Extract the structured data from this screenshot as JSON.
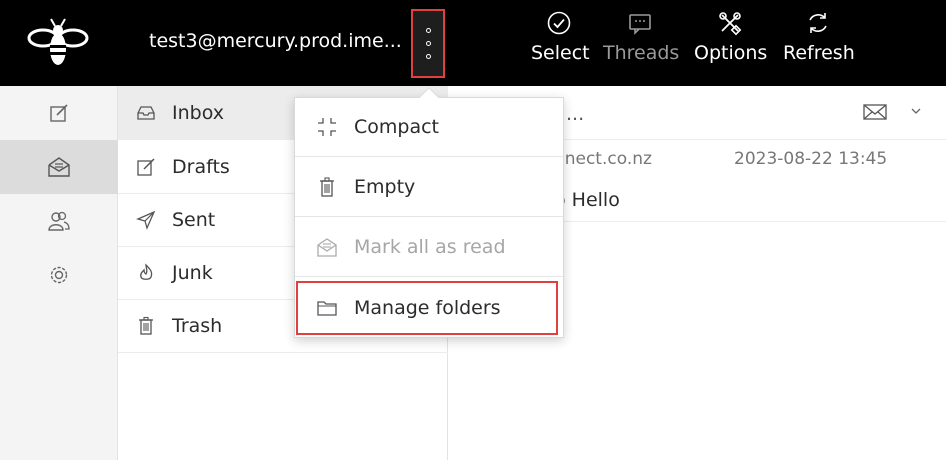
{
  "header": {
    "account": "test3@mercury.prod.ime...",
    "buttons": [
      {
        "label": "Select",
        "icon": "check-circle-icon",
        "disabled": false
      },
      {
        "label": "Threads",
        "icon": "threads-icon",
        "disabled": true
      },
      {
        "label": "Options",
        "icon": "options-tools-icon",
        "disabled": false
      },
      {
        "label": "Refresh",
        "icon": "refresh-icon",
        "disabled": false
      }
    ]
  },
  "sidebar": {
    "icons": [
      {
        "icon": "compose-icon"
      },
      {
        "icon": "mail-icon",
        "active": true
      },
      {
        "icon": "contacts-icon"
      },
      {
        "icon": "settings-icon"
      }
    ]
  },
  "folders": [
    {
      "name": "Inbox",
      "icon": "inbox-icon",
      "active": true
    },
    {
      "name": "Drafts",
      "icon": "drafts-icon"
    },
    {
      "name": "Sent",
      "icon": "sent-icon"
    },
    {
      "name": "Junk",
      "icon": "junk-icon"
    },
    {
      "name": "Trash",
      "icon": "trash-icon"
    }
  ],
  "message_list": {
    "title": "...",
    "messages": [
      {
        "from": "inect.co.nz",
        "date": "2023-08-22 13:45",
        "subject": "o Hello"
      }
    ]
  },
  "folder_menu": {
    "items": [
      {
        "label": "Compact",
        "icon": "compact-icon",
        "disabled": false
      },
      {
        "label": "Empty",
        "icon": "trash-icon",
        "disabled": false
      },
      {
        "label": "Mark all as read",
        "icon": "mark-read-icon",
        "disabled": true
      },
      {
        "label": "Manage folders",
        "icon": "folder-icon",
        "disabled": false,
        "highlighted": true
      }
    ]
  },
  "colors": {
    "topbar": "#000000",
    "highlight": "#e04040",
    "active_row": "#ececec"
  }
}
